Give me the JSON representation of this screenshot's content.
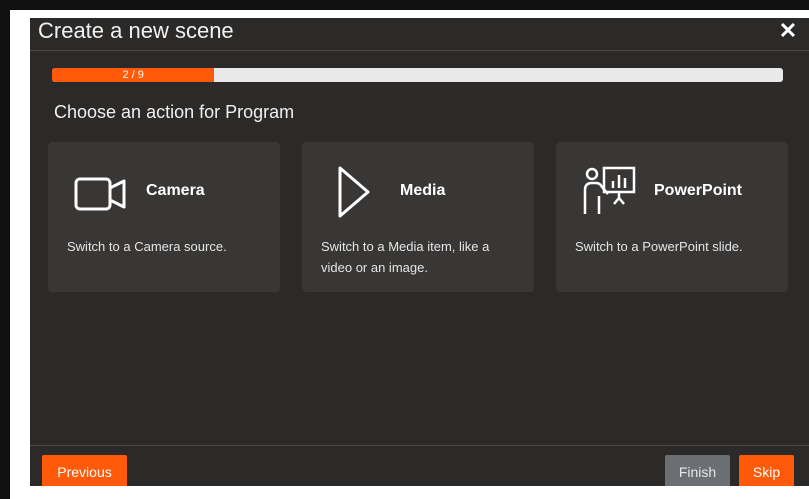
{
  "dialog": {
    "title": "Create a new scene",
    "close_symbol": "✕"
  },
  "progress": {
    "label": "2 / 9",
    "current": 2,
    "total": 9
  },
  "subheading": "Choose an action for Program",
  "cards": [
    {
      "icon": "video-camera-icon",
      "title": "Camera",
      "description": "Switch to a Camera source."
    },
    {
      "icon": "play-triangle-icon",
      "title": "Media",
      "description": "Switch to a Media item, like a video or an image."
    },
    {
      "icon": "presenter-board-icon",
      "title": "PowerPoint",
      "description": "Switch to a PowerPoint slide."
    }
  ],
  "footer": {
    "previous_label": "Previous",
    "finish_label": "Finish",
    "skip_label": "Skip"
  },
  "colors": {
    "accent": "#ff5a0a",
    "dialog_bg": "#2b2a29",
    "card_bg": "#383736",
    "finish_bg": "#6b6f74"
  }
}
